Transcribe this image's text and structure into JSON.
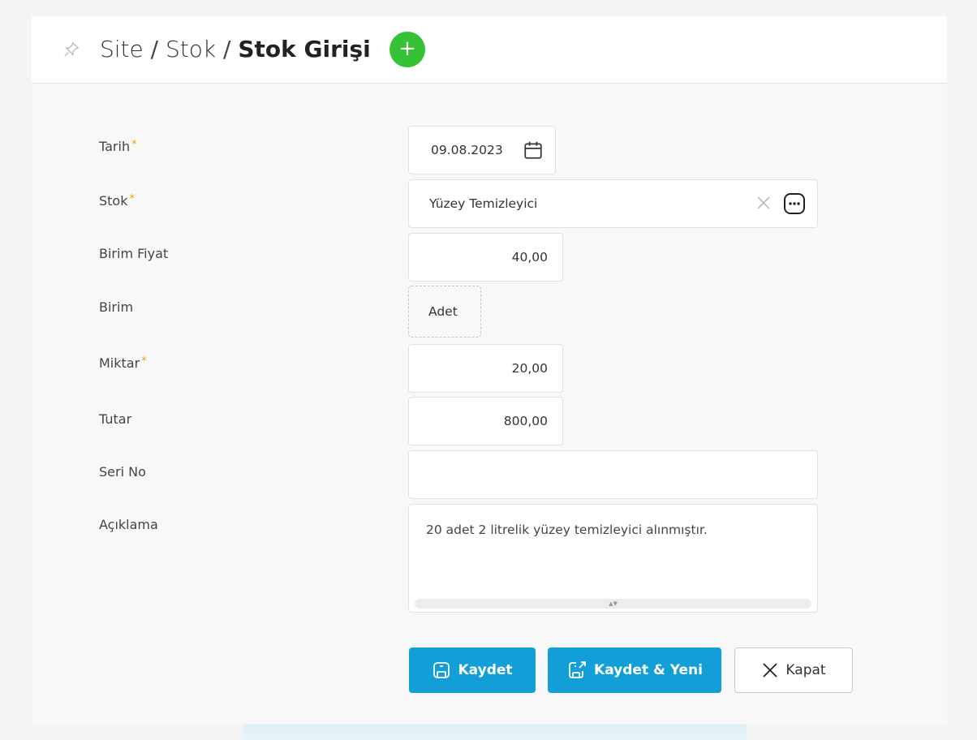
{
  "breadcrumb": {
    "part1": "Site",
    "sep1": " / ",
    "part2": "Stok",
    "sep2": " / ",
    "current": "Stok Girişi",
    "add_symbol": "+"
  },
  "form": {
    "required_marker": "*",
    "tarih": {
      "label": "Tarih",
      "value": "09.08.2023",
      "required": true
    },
    "stok": {
      "label": "Stok",
      "value": "Yüzey Temizleyici",
      "required": true
    },
    "birim_fiyat": {
      "label": "Birim Fiyat",
      "value": "40,00"
    },
    "birim": {
      "label": "Birim",
      "value": "Adet"
    },
    "miktar": {
      "label": "Miktar",
      "value": "20,00",
      "required": true
    },
    "tutar": {
      "label": "Tutar",
      "value": "800,00"
    },
    "seri_no": {
      "label": "Seri No",
      "value": ""
    },
    "aciklama": {
      "label": "Açıklama",
      "value": "20 adet 2 litrelik yüzey temizleyici alınmıştır."
    }
  },
  "buttons": {
    "save": "Kaydet",
    "save_new": "Kaydet & Yeni",
    "close": "Kapat"
  },
  "icons": {
    "pin": "pin-icon",
    "add": "plus-circle-icon",
    "calendar": "calendar-icon",
    "clear": "close-icon",
    "lookup": "more-dots-icon",
    "save": "floppy-icon",
    "save_new": "floppy-export-icon",
    "close": "close-icon"
  },
  "colors": {
    "primary": "#129fd8",
    "add_button": "#35c235",
    "required": "#f2a000"
  }
}
